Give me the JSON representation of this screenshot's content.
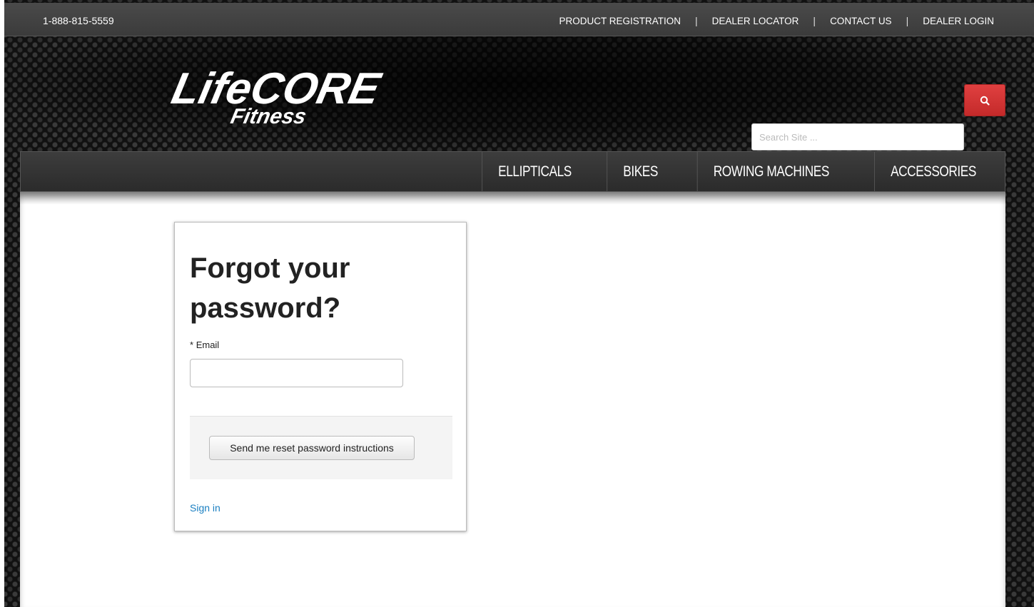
{
  "topbar": {
    "phone": "1-888-815-5559",
    "links": [
      "PRODUCT REGISTRATION",
      "DEALER LOCATOR",
      "CONTACT US",
      "DEALER LOGIN"
    ],
    "separator": "|"
  },
  "header": {
    "logo_text_main": "LifeCORE",
    "logo_text_sub": "Fitness",
    "search_placeholder": "Search Site ...",
    "search_icon": "search-icon"
  },
  "nav": {
    "items": [
      "ELLIPTICALS",
      "BIKES",
      "ROWING MACHINES",
      "ACCESSORIES"
    ]
  },
  "form": {
    "title": "Forgot your password?",
    "required_mark": "*",
    "email_label": "Email",
    "email_value": "",
    "submit_label": "Send me reset password instructions",
    "signin_link": "Sign in"
  },
  "colors": {
    "accent_red": "#d63333",
    "link_blue": "#1a7fc1"
  }
}
